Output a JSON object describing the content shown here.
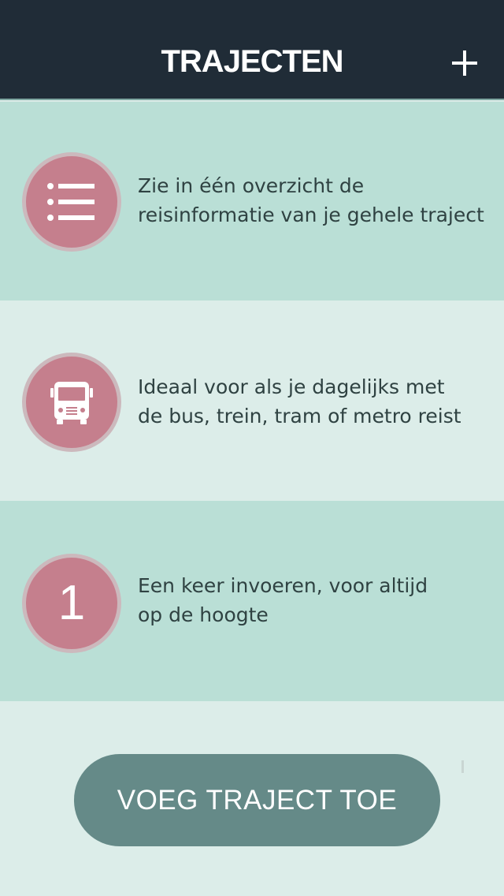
{
  "header": {
    "title": "TRAJECTEN",
    "add_icon": "plus-icon"
  },
  "features": [
    {
      "icon": "list-icon",
      "line1": "Zie in één overzicht de",
      "line2": "reisinformatie van je gehele traject"
    },
    {
      "icon": "bus-icon",
      "line1": "Ideaal voor als je dagelijks met",
      "line2": "de bus, trein, tram of metro reist"
    },
    {
      "icon": "number-one-icon",
      "number": "1",
      "line1": "Een keer invoeren, voor altijd",
      "line2": "op de hoogte"
    }
  ],
  "cta": {
    "label": "VOEG TRAJECT TOE"
  },
  "colors": {
    "header_bg": "#202c37",
    "accent_pink": "#c57f8d",
    "row_dark": "#badfd6",
    "row_light": "#dcede9",
    "button_bg": "#658a88"
  }
}
